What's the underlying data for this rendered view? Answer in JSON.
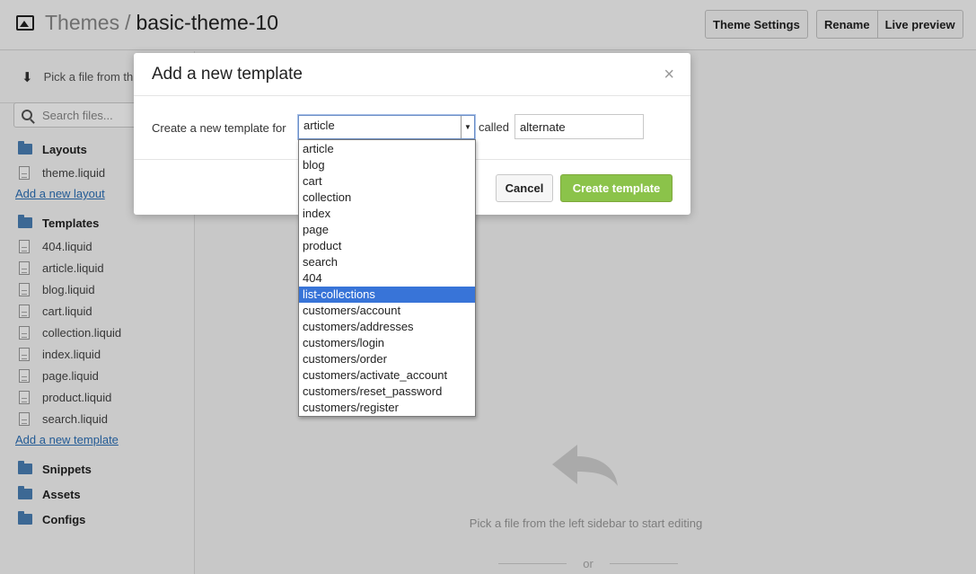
{
  "header": {
    "section": "Themes",
    "separator": "/",
    "theme_name": "basic-theme-10",
    "theme_settings_label": "Theme Settings",
    "rename_label": "Rename",
    "live_preview_label": "Live preview"
  },
  "sidebar": {
    "pick_text": "Pick a file from th",
    "search_placeholder": "Search files...",
    "layouts": {
      "title": "Layouts",
      "files": [
        "theme.liquid"
      ],
      "add_label": "Add a new layout"
    },
    "templates": {
      "title": "Templates",
      "files": [
        "404.liquid",
        "article.liquid",
        "blog.liquid",
        "cart.liquid",
        "collection.liquid",
        "index.liquid",
        "page.liquid",
        "product.liquid",
        "search.liquid"
      ],
      "add_label": "Add a new template"
    },
    "snippets_title": "Snippets",
    "assets_title": "Assets",
    "configs_title": "Configs"
  },
  "main": {
    "hint": "Pick a file from the left sidebar to start editing",
    "or_label": "or"
  },
  "modal": {
    "title": "Add a new template",
    "close_symbol": "×",
    "prompt": "Create a new template for",
    "selected_value": "article",
    "called_label": "called",
    "name_value": "alternate",
    "cancel_label": "Cancel",
    "create_label": "Create template"
  },
  "dropdown": {
    "highlighted": "list-collections",
    "options": [
      "article",
      "blog",
      "cart",
      "collection",
      "index",
      "page",
      "product",
      "search",
      "404",
      "list-collections",
      "customers/account",
      "customers/addresses",
      "customers/login",
      "customers/order",
      "customers/activate_account",
      "customers/reset_password",
      "customers/register"
    ]
  },
  "colors": {
    "accent_green": "#8bc34a",
    "highlight_blue": "#3874d8",
    "link_blue": "#2b6fb6"
  }
}
